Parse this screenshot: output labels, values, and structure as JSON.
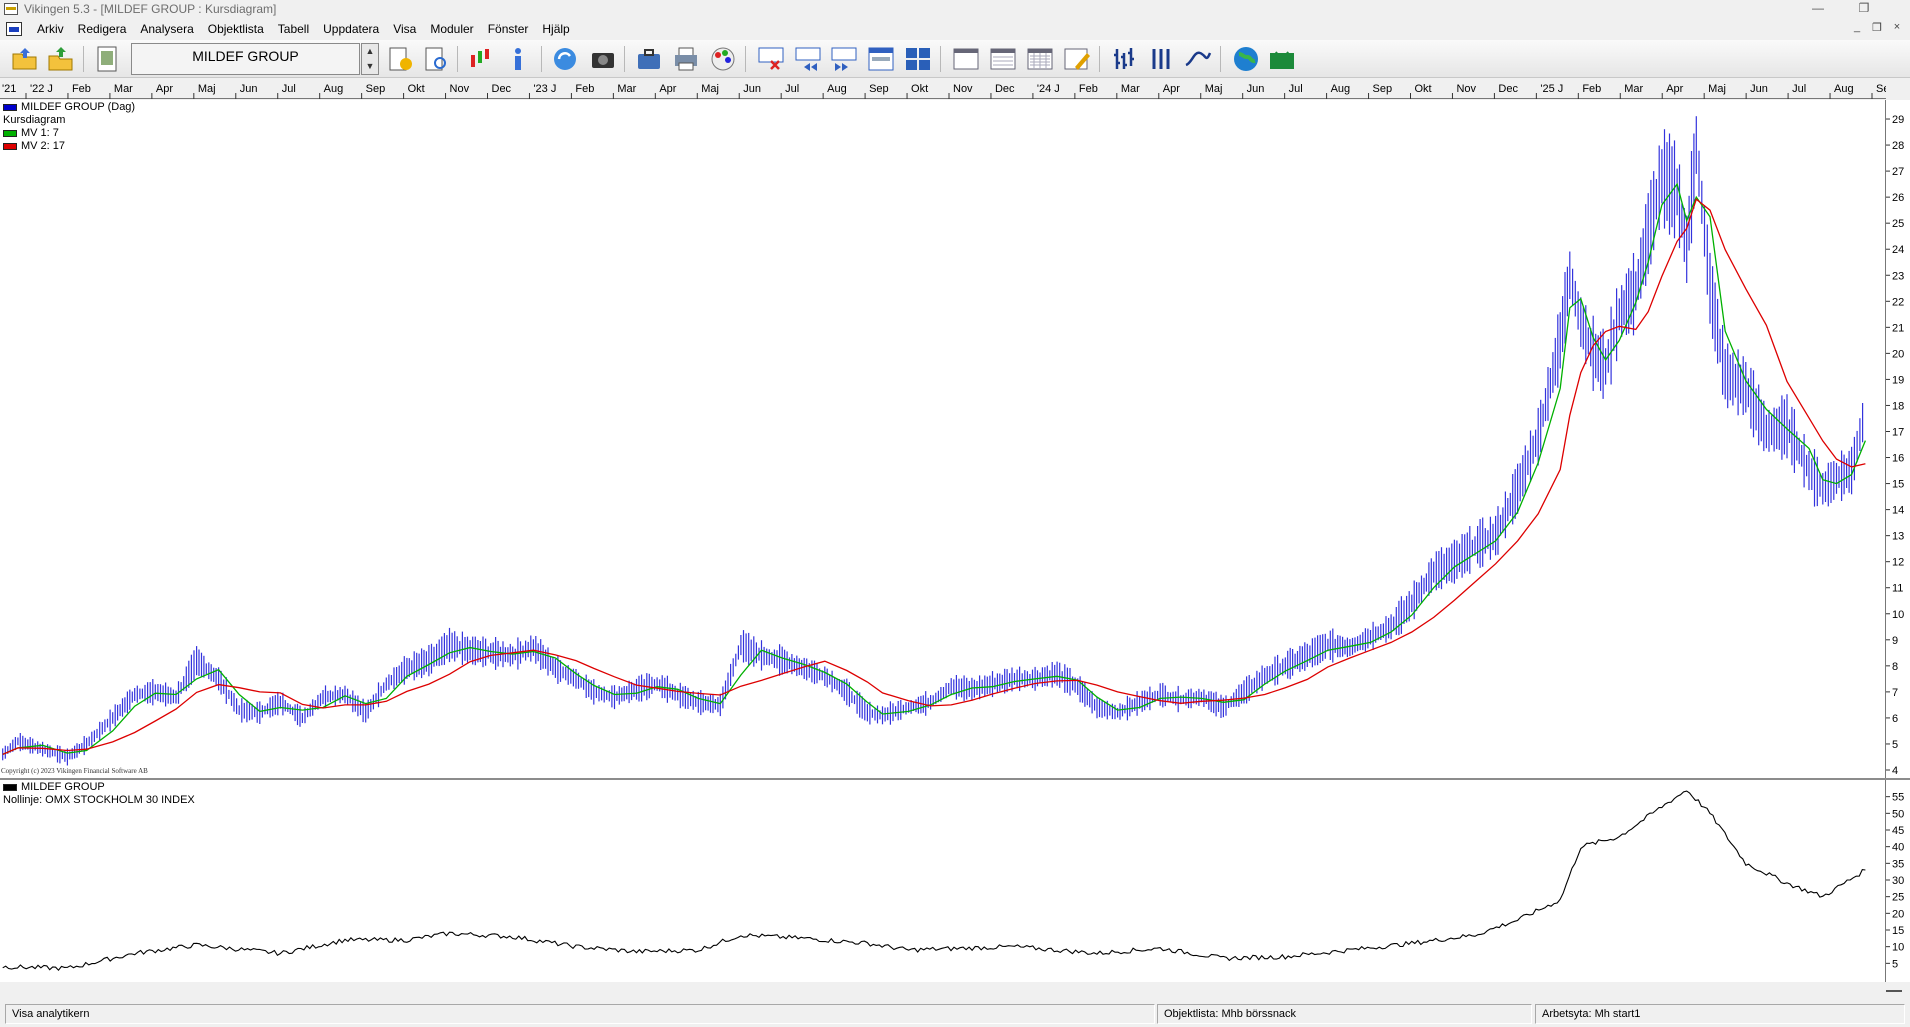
{
  "window": {
    "title": "Vikingen 5.3 - [MILDEF GROUP : Kursdiagram]",
    "min_glyph": "—",
    "restore_glyph": "❐",
    "mdi_min_glyph": "_",
    "mdi_restore_glyph": "❐",
    "mdi_close_glyph": "×"
  },
  "menu": [
    "Arkiv",
    "Redigera",
    "Analysera",
    "Objektlista",
    "Tabell",
    "Uppdatera",
    "Visa",
    "Moduler",
    "Fönster",
    "Hjälp"
  ],
  "toolbar": {
    "security_name": "MILDEF GROUP",
    "spin_up": "▲",
    "spin_down": "▼",
    "icons": [
      "open-folder-icon",
      "export-folder-icon",
      "notebook-icon",
      "favorite-list-icon",
      "list-search-icon",
      "candlestick-chart-icon",
      "info-icon",
      "refresh-icon",
      "camera-icon",
      "briefcase-icon",
      "printer-icon",
      "color-palette-icon",
      "delete-window-icon",
      "rewind-icon",
      "fast-forward-icon",
      "window-layout-icon",
      "grid-1234-icon",
      "calendar-week-icon",
      "calendar-month-icon",
      "calendar-year-icon",
      "calendar-edit-icon",
      "ohlc-bars-icon",
      "volume-bars-icon",
      "line-chart-icon",
      "globe-icon",
      "bull-www-icon"
    ]
  },
  "time_axis": {
    "labels": [
      "'21",
      "'22 J",
      "Feb",
      "Mar",
      "Apr",
      "Maj",
      "Jun",
      "Jul",
      "Aug",
      "Sep",
      "Okt",
      "Nov",
      "Dec",
      "'23 J",
      "Feb",
      "Mar",
      "Apr",
      "Maj",
      "Jun",
      "Jul",
      "Aug",
      "Sep",
      "Okt",
      "Nov",
      "Dec",
      "'24 J",
      "Feb",
      "Mar",
      "Apr",
      "Maj",
      "Jun",
      "Jul",
      "Aug",
      "Sep",
      "Okt",
      "Nov",
      "Dec",
      "'25 J",
      "Feb",
      "Mar",
      "Apr",
      "Maj",
      "Jun",
      "Jul",
      "Aug",
      "Sep"
    ]
  },
  "price_pane": {
    "legend": [
      {
        "label": "MILDEF GROUP (Dag)",
        "color": "#0000cc"
      },
      {
        "label": "Kursdiagram",
        "color": ""
      },
      {
        "label": "MV 1: 7",
        "color": "#00b000"
      },
      {
        "label": "MV 2: 17",
        "color": "#dd0000"
      }
    ],
    "copyright": "Copyright (c) 2023 Vikingen Financial Software AB"
  },
  "osc_pane": {
    "legend": [
      {
        "label": "MILDEF GROUP",
        "color": "#000000"
      },
      {
        "label": "Nollinje: OMX STOCKHOLM 30 INDEX",
        "color": ""
      }
    ]
  },
  "statusbar": {
    "left": "Visa analytikern",
    "middle": "Objektlista: Mhb börssnack",
    "right": "Arbetsyta: Mh start1"
  },
  "chart_data": [
    {
      "type": "line",
      "title": "MILDEF GROUP (Dag)",
      "subtitle": "Kursdiagram",
      "bar_color": "#3333dd",
      "colors": {
        "price": "#3333dd",
        "mv1": "#00b000",
        "mv2": "#dd0000"
      },
      "x": [
        "2021-12-30",
        "2022-01-10",
        "2022-01-28",
        "2022-02-15",
        "2022-03-01",
        "2022-03-20",
        "2022-04-05",
        "2022-04-20",
        "2022-05-05",
        "2022-05-20",
        "2022-06-05",
        "2022-06-20",
        "2022-07-05",
        "2022-07-20",
        "2022-08-05",
        "2022-08-20",
        "2022-09-05",
        "2022-09-20",
        "2022-10-05",
        "2022-10-20",
        "2022-11-05",
        "2022-11-20",
        "2022-12-05",
        "2022-12-20",
        "2023-01-05",
        "2023-01-20",
        "2023-02-05",
        "2023-02-20",
        "2023-03-05",
        "2023-03-20",
        "2023-04-05",
        "2023-04-20",
        "2023-05-05",
        "2023-05-20",
        "2023-06-05",
        "2023-06-20",
        "2023-07-05",
        "2023-07-20",
        "2023-08-05",
        "2023-08-20",
        "2023-09-05",
        "2023-09-20",
        "2023-10-01",
        "2023-10-20",
        "2023-11-05",
        "2023-11-20",
        "2023-12-05",
        "2023-12-20",
        "2024-01-05",
        "2024-01-20",
        "2024-02-05",
        "2024-02-20",
        "2024-03-05",
        "2024-03-20",
        "2024-04-05",
        "2024-04-20",
        "2024-05-05",
        "2024-05-20",
        "2024-06-05",
        "2024-06-20",
        "2024-07-05",
        "2024-07-20",
        "2024-08-05",
        "2024-08-20",
        "2024-09-05",
        "2024-09-20",
        "2024-10-05",
        "2024-10-20",
        "2024-11-05",
        "2024-11-20",
        "2024-12-05",
        "2024-12-20",
        "2025-01-05",
        "2025-01-20",
        "2025-02-05",
        "2025-02-12",
        "2025-02-20",
        "2025-03-01",
        "2025-03-10",
        "2025-03-20",
        "2025-04-01",
        "2025-04-10",
        "2025-04-20",
        "2025-05-01",
        "2025-05-08",
        "2025-05-15",
        "2025-05-25",
        "2025-06-05",
        "2025-06-20",
        "2025-07-05",
        "2025-07-20",
        "2025-08-05",
        "2025-08-15",
        "2025-08-25",
        "2025-09-05",
        "2025-09-15"
      ],
      "close": [
        4.6,
        5.1,
        4.8,
        4.5,
        5.0,
        6.0,
        6.9,
        7.0,
        6.8,
        8.2,
        7.5,
        6.3,
        6.2,
        6.6,
        6.0,
        6.8,
        6.9,
        6.2,
        7.3,
        7.9,
        8.2,
        8.8,
        8.6,
        8.5,
        8.4,
        8.7,
        7.9,
        7.5,
        7.0,
        6.8,
        7.1,
        7.3,
        6.9,
        6.6,
        6.5,
        8.8,
        8.4,
        8.2,
        7.9,
        7.6,
        7.0,
        6.2,
        6.1,
        6.4,
        6.6,
        7.2,
        7.1,
        7.3,
        7.5,
        7.5,
        7.7,
        7.2,
        6.4,
        6.2,
        6.6,
        6.9,
        6.7,
        6.8,
        6.4,
        7.0,
        7.6,
        8.0,
        8.4,
        8.8,
        8.7,
        9.1,
        9.5,
        10.4,
        11.6,
        12.0,
        12.6,
        13.0,
        14.8,
        16.8,
        20.5,
        23.0,
        21.2,
        20.0,
        19.5,
        21.5,
        22.4,
        24.6,
        26.8,
        26.2,
        24.0,
        28.0,
        22.5,
        19.2,
        18.7,
        17.0,
        17.2,
        15.5,
        14.8,
        15.2,
        15.5,
        17.8
      ],
      "mv1_period": 7,
      "mv2_period": 17,
      "ylim": [
        4,
        29.5
      ],
      "yticks": [
        4,
        5,
        6,
        7,
        8,
        9,
        10,
        11,
        12,
        13,
        14,
        15,
        16,
        17,
        18,
        19,
        20,
        21,
        22,
        23,
        24,
        25,
        26,
        27,
        28,
        29
      ]
    },
    {
      "type": "line",
      "title": "MILDEF GROUP",
      "subtitle": "Nollinje: OMX STOCKHOLM 30 INDEX",
      "color": "#000000",
      "ylim": [
        0,
        57
      ],
      "yticks": [
        5,
        10,
        15,
        20,
        25,
        30,
        35,
        40,
        45,
        50,
        55
      ],
      "x": [
        "2021-12-30",
        "2022-02-15",
        "2022-04-05",
        "2022-05-20",
        "2022-07-20",
        "2022-09-05",
        "2022-10-20",
        "2022-11-20",
        "2023-01-05",
        "2023-02-20",
        "2023-04-05",
        "2023-05-20",
        "2023-06-20",
        "2023-08-05",
        "2023-09-20",
        "2023-10-20",
        "2024-01-05",
        "2024-03-05",
        "2024-04-20",
        "2024-06-05",
        "2024-07-20",
        "2024-09-05",
        "2024-10-20",
        "2024-12-05",
        "2025-01-05",
        "2025-02-05",
        "2025-02-20",
        "2025-03-20",
        "2025-04-20",
        "2025-05-08",
        "2025-05-25",
        "2025-06-20",
        "2025-07-20",
        "2025-08-15",
        "2025-09-15"
      ],
      "values": [
        4,
        3.5,
        8,
        10.5,
        8,
        12,
        12,
        14,
        13,
        10,
        8.5,
        9,
        13.5,
        12.5,
        11,
        9,
        10,
        8,
        9.5,
        6.5,
        7,
        9,
        11,
        13.5,
        18,
        24,
        40,
        43,
        52,
        57,
        50,
        35,
        29,
        25,
        33
      ]
    }
  ]
}
